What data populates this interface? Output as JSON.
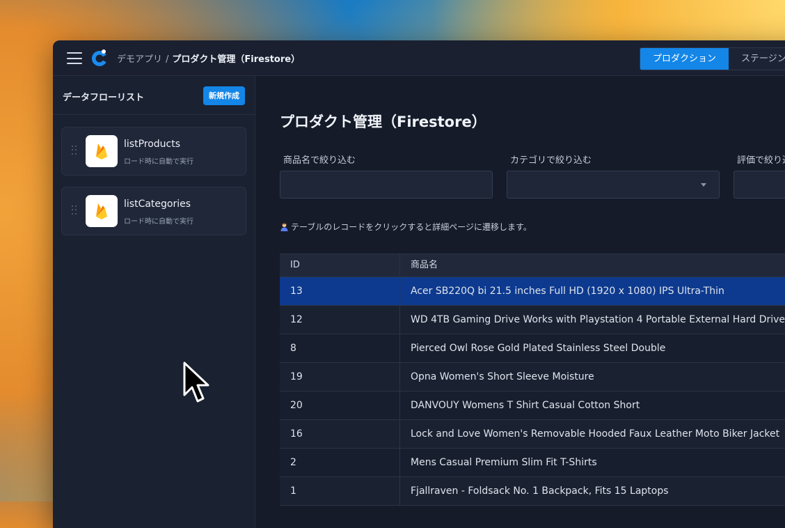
{
  "app": {
    "breadcrumb_root": "デモアプリ",
    "breadcrumb_sep": "/",
    "breadcrumb_current": "プロダクト管理（Firestore）"
  },
  "env_toggle": {
    "active": "プロダクション",
    "other": "ステージン"
  },
  "sidebar": {
    "title": "データフローリスト",
    "new_button": "新規作成",
    "flows": [
      {
        "name": "listProducts",
        "subtitle": "ロード時に自動で実行",
        "icon": "firebase-icon"
      },
      {
        "name": "listCategories",
        "subtitle": "ロード時に自動で実行",
        "icon": "firebase-icon"
      }
    ]
  },
  "main": {
    "title": "プロダクト管理（Firestore）",
    "filters": [
      {
        "label": "商品名で絞り込む",
        "type": "text"
      },
      {
        "label": "カテゴリで絞り込む",
        "type": "select"
      },
      {
        "label": "評価で絞り込む",
        "type": "text"
      }
    ],
    "hint": "テーブルのレコードをクリックすると詳細ページに遷移します。",
    "table": {
      "columns": [
        "ID",
        "商品名"
      ],
      "rows": [
        {
          "id": "13",
          "name": "Acer SB220Q bi 21.5 inches Full HD (1920 x 1080) IPS Ultra-Thin",
          "selected": true
        },
        {
          "id": "12",
          "name": "WD 4TB Gaming Drive Works with Playstation 4 Portable External Hard Drive"
        },
        {
          "id": "8",
          "name": "Pierced Owl Rose Gold Plated Stainless Steel Double"
        },
        {
          "id": "19",
          "name": "Opna Women's Short Sleeve Moisture"
        },
        {
          "id": "20",
          "name": "DANVOUY Womens T Shirt Casual Cotton Short"
        },
        {
          "id": "16",
          "name": "Lock and Love Women's Removable Hooded Faux Leather Moto Biker Jacket"
        },
        {
          "id": "2",
          "name": "Mens Casual Premium Slim Fit T-Shirts"
        },
        {
          "id": "1",
          "name": "Fjallraven - Foldsack No. 1 Backpack, Fits 15 Laptops"
        }
      ]
    }
  },
  "colors": {
    "accent": "#1386e8",
    "selected_row": "#0d3a8f",
    "background": "#151b29"
  }
}
